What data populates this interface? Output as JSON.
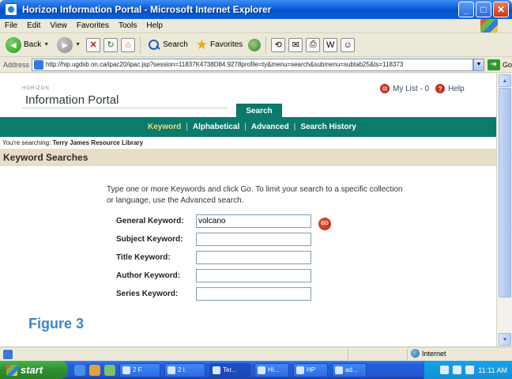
{
  "window": {
    "title": "Horizon Information Portal - Microsoft Internet Explorer",
    "controls": [
      "minimize",
      "maximize",
      "close"
    ]
  },
  "menu": [
    "File",
    "Edit",
    "View",
    "Favorites",
    "Tools",
    "Help"
  ],
  "toolbar": {
    "back_label": "Back",
    "search_label": "Search",
    "favorites_label": "Favorites"
  },
  "address": {
    "label": "Address",
    "url": "http://hip.ugdsb.on.ca/ipac20/ipac.jsp?session=11837K4738D84.9278profile=ty&menu=search&submenu=subtab25&ts=118373",
    "go_label": "Go"
  },
  "page": {
    "horizon_small": "HORIZON",
    "portal_title": "Information Portal",
    "mylist_label": "My List - 0",
    "help_label": "Help",
    "search_tab": "Search",
    "nav": {
      "keyword": "Keyword",
      "alphabetical": "Alphabetical",
      "advanced": "Advanced",
      "history": "Search History"
    },
    "searching_prefix": "You're searching:",
    "searching_library": "Terry James Resource Library",
    "section_title": "Keyword Searches",
    "instructions": "Type one or more Keywords and click Go. To limit your search to a specific collection or language, use the Advanced search.",
    "fields": [
      {
        "label": "General Keyword:",
        "value": "volcano"
      },
      {
        "label": "Subject Keyword:",
        "value": ""
      },
      {
        "label": "Title Keyword:",
        "value": ""
      },
      {
        "label": "Author Keyword:",
        "value": ""
      },
      {
        "label": "Series Keyword:",
        "value": ""
      }
    ],
    "go_button": "GO"
  },
  "caption": "Figure 3",
  "status": {
    "zone": "Internet"
  },
  "taskbar": {
    "start": "start",
    "tasks": [
      "2 F.",
      "2 I.",
      "Ter...",
      "HI...",
      "HP",
      "ad..."
    ],
    "clock": "11:11 AM"
  }
}
